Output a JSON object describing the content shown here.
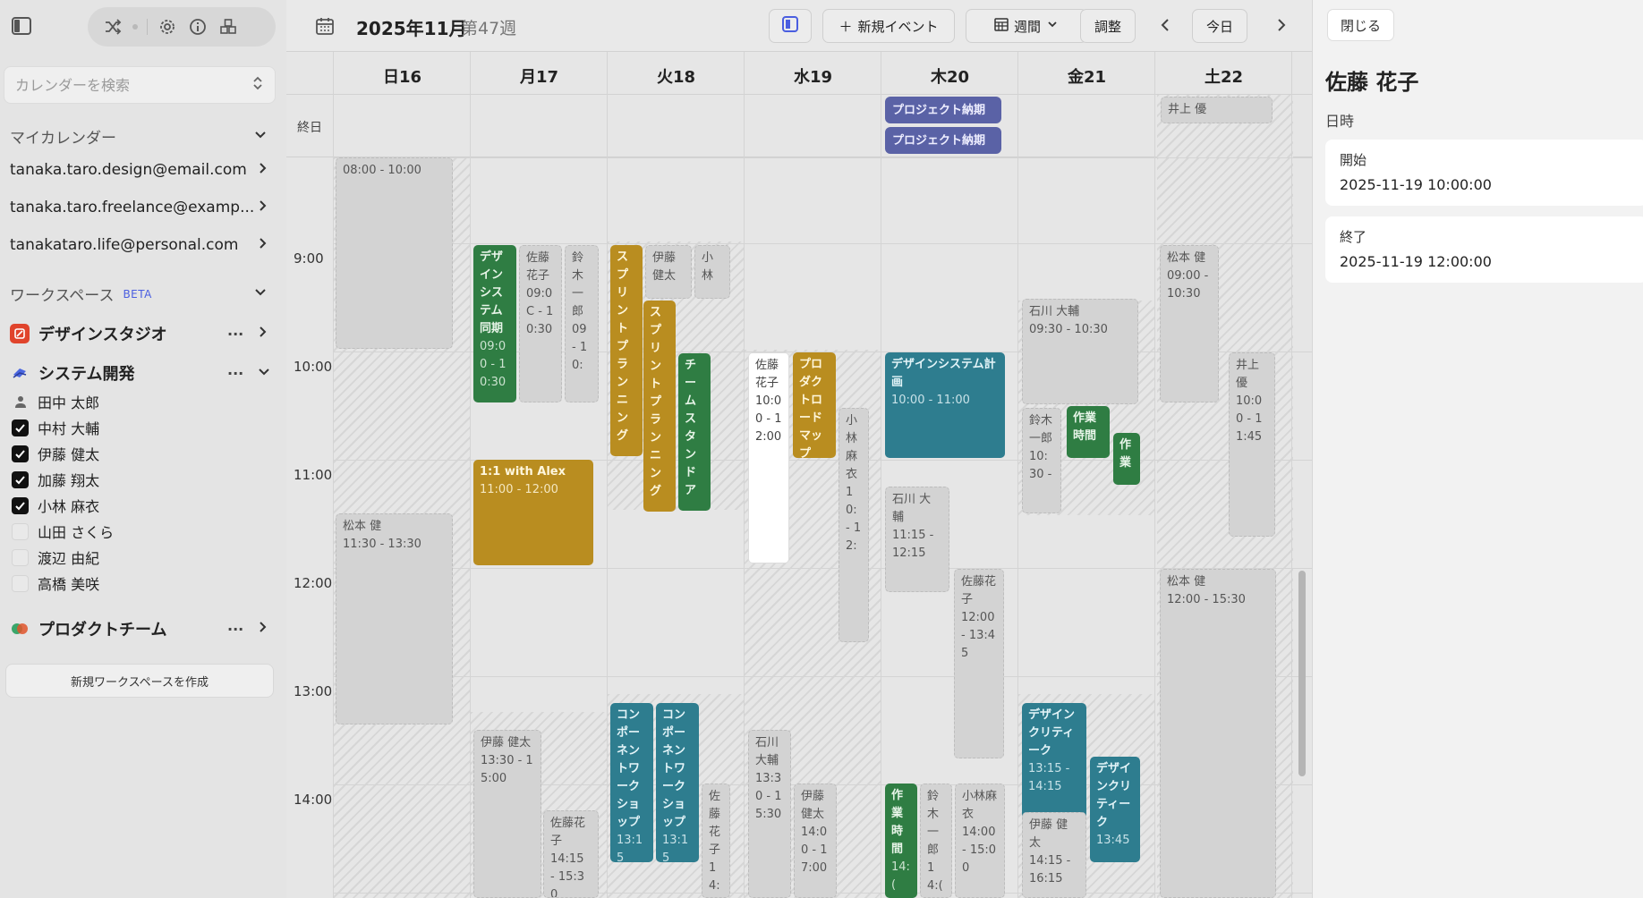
{
  "sidebar": {
    "search_placeholder": "カレンダーを検索",
    "my_calendars_title": "マイカレンダー",
    "calendars": [
      "tanaka.taro.design@email.com",
      "tanaka.taro.freelance@examp...",
      "tanakataro.life@personal.com"
    ],
    "workspace_title": "ワークスペース",
    "workspace_badge": "BETA",
    "workspaces": [
      {
        "name": "デザインスタジオ",
        "icon": "design-studio-icon",
        "color": "#e0442c"
      },
      {
        "name": "システム開発",
        "icon": "system-dev-icon",
        "color": "#4a66e0"
      }
    ],
    "members": [
      {
        "name": "田中 太郎",
        "state": "owner"
      },
      {
        "name": "中村 大輔",
        "state": "checked"
      },
      {
        "name": "伊藤 健太",
        "state": "checked"
      },
      {
        "name": "加藤 翔太",
        "state": "checked"
      },
      {
        "name": "小林 麻衣",
        "state": "checked"
      },
      {
        "name": "山田 さくら",
        "state": "unchecked"
      },
      {
        "name": "渡辺 由紀",
        "state": "unchecked"
      },
      {
        "name": "高橋 美咲",
        "state": "unchecked"
      }
    ],
    "product_team": "プロダクトチーム",
    "new_workspace": "新規ワークスペースを作成",
    "more_label": "···"
  },
  "toolbar": {
    "month_title": "2025年11月",
    "week_label": "第47週",
    "new_event": "新規イベント",
    "view_select": "週間",
    "adjust": "調整",
    "today": "今日"
  },
  "days": [
    "日16",
    "月17",
    "火18",
    "水19",
    "木20",
    "金21",
    "土22"
  ],
  "all_day_label": "終日",
  "all_day_events": {
    "thu1": "プロジェクト納期",
    "thu2": "プロジェクト納期",
    "sat1": "井上 優"
  },
  "times": [
    "9:00",
    "10:00",
    "11:00",
    "12:00",
    "13:00",
    "14:00"
  ],
  "events": {
    "sun_a": {
      "time": "08:00 - 10:00"
    },
    "sun_b": {
      "title": "松本 健",
      "time": "11:30 - 13:30"
    },
    "mon_design": {
      "title": "デザインシステム同期",
      "time": "09:00 - 10:30"
    },
    "mon_sato": {
      "title": "佐藤花子",
      "time": "09:0C - 10:30"
    },
    "mon_suzuki": {
      "title": "鈴木一郎",
      "time": "09 - 10:"
    },
    "mon_1on1": {
      "title": "1:1 with Alex",
      "time": "11:00 - 12:00"
    },
    "mon_ito": {
      "title": "伊藤 健太",
      "time": "13:30 - 15:00"
    },
    "mon_sato2": {
      "title": "佐藤花子",
      "time": "14:15 - 15:30"
    },
    "tue_sprint1": {
      "title": "スプリントプランニング"
    },
    "tue_ito": {
      "title": "伊藤健太"
    },
    "tue_kobayashi": {
      "title": "小林"
    },
    "tue_sprint2": {
      "title": "スプリントプランニング"
    },
    "tue_standup": {
      "title": "チームスタンドア"
    },
    "tue_comp1": {
      "title": "コンポーネントワークショップ",
      "time": "13:15"
    },
    "tue_comp2": {
      "title": "コンポーネントワークショップ",
      "time": "13:15"
    },
    "tue_sato": {
      "title": "佐藤花子",
      "time": "14:"
    },
    "wed_sato": {
      "title": "佐藤花子",
      "time": "10:00 - 12:00"
    },
    "wed_product": {
      "title": "プロダクトロードマップ"
    },
    "wed_kobayashi": {
      "title": "小林麻衣",
      "time": "10: - 12:"
    },
    "wed_ishikawa": {
      "title": "石川大輔",
      "time": "13:30 - 15:30"
    },
    "wed_ito": {
      "title": "伊藤健太",
      "time": "14:00 - 17:00"
    },
    "thu_design": {
      "title": "デザインシステム計画",
      "time": "10:00 - 11:00"
    },
    "thu_ishikawa": {
      "title": "石川 大輔",
      "time": "11:15 - 12:15"
    },
    "thu_sato": {
      "title": "佐藤花子",
      "time": "12:00 - 13:45"
    },
    "thu_work": {
      "title": "作業時間",
      "time": "14:("
    },
    "thu_suzuki": {
      "title": "鈴木一郎",
      "time": "14:("
    },
    "thu_kobayashi": {
      "title": "小林麻衣",
      "time": "14:00 - 15:00"
    },
    "fri_ishikawa": {
      "title": "石川 大輔",
      "time": "09:30 - 10:30"
    },
    "fri_suzuki": {
      "title": "鈴木一郎",
      "time": "10:30 -"
    },
    "fri_work1": {
      "title": "作業時間"
    },
    "fri_work2": {
      "title": "作業"
    },
    "fri_dc1": {
      "title": "デザインクリティーク",
      "time": "13:15 - 14:15"
    },
    "fri_dc2": {
      "title": "デザインクリティーク",
      "time": "13:45"
    },
    "fri_ito": {
      "title": "伊藤 健太",
      "time": "14:15 - 16:15"
    },
    "sat_matsumoto": {
      "title": "松本 健",
      "time": "09:00 - 10:30"
    },
    "sat_inoue": {
      "title": "井上優",
      "time": "10:00 - 11:45"
    },
    "sat_matsumoto2": {
      "title": "松本 健",
      "time": "12:00 - 15:30"
    }
  },
  "panel": {
    "close": "閉じる",
    "name": "佐藤 花子",
    "datetime_label": "日時",
    "start_label": "開始",
    "start_value": "2025-11-19  10:00:00",
    "end_label": "終了",
    "end_value": "2025-11-19  12:00:00"
  },
  "colors": {
    "green": "#2f7d43",
    "yellow": "#b98d20",
    "teal": "#2e7d8f",
    "purple": "#5a62a6",
    "accent_blue": "#4a5ee0"
  }
}
